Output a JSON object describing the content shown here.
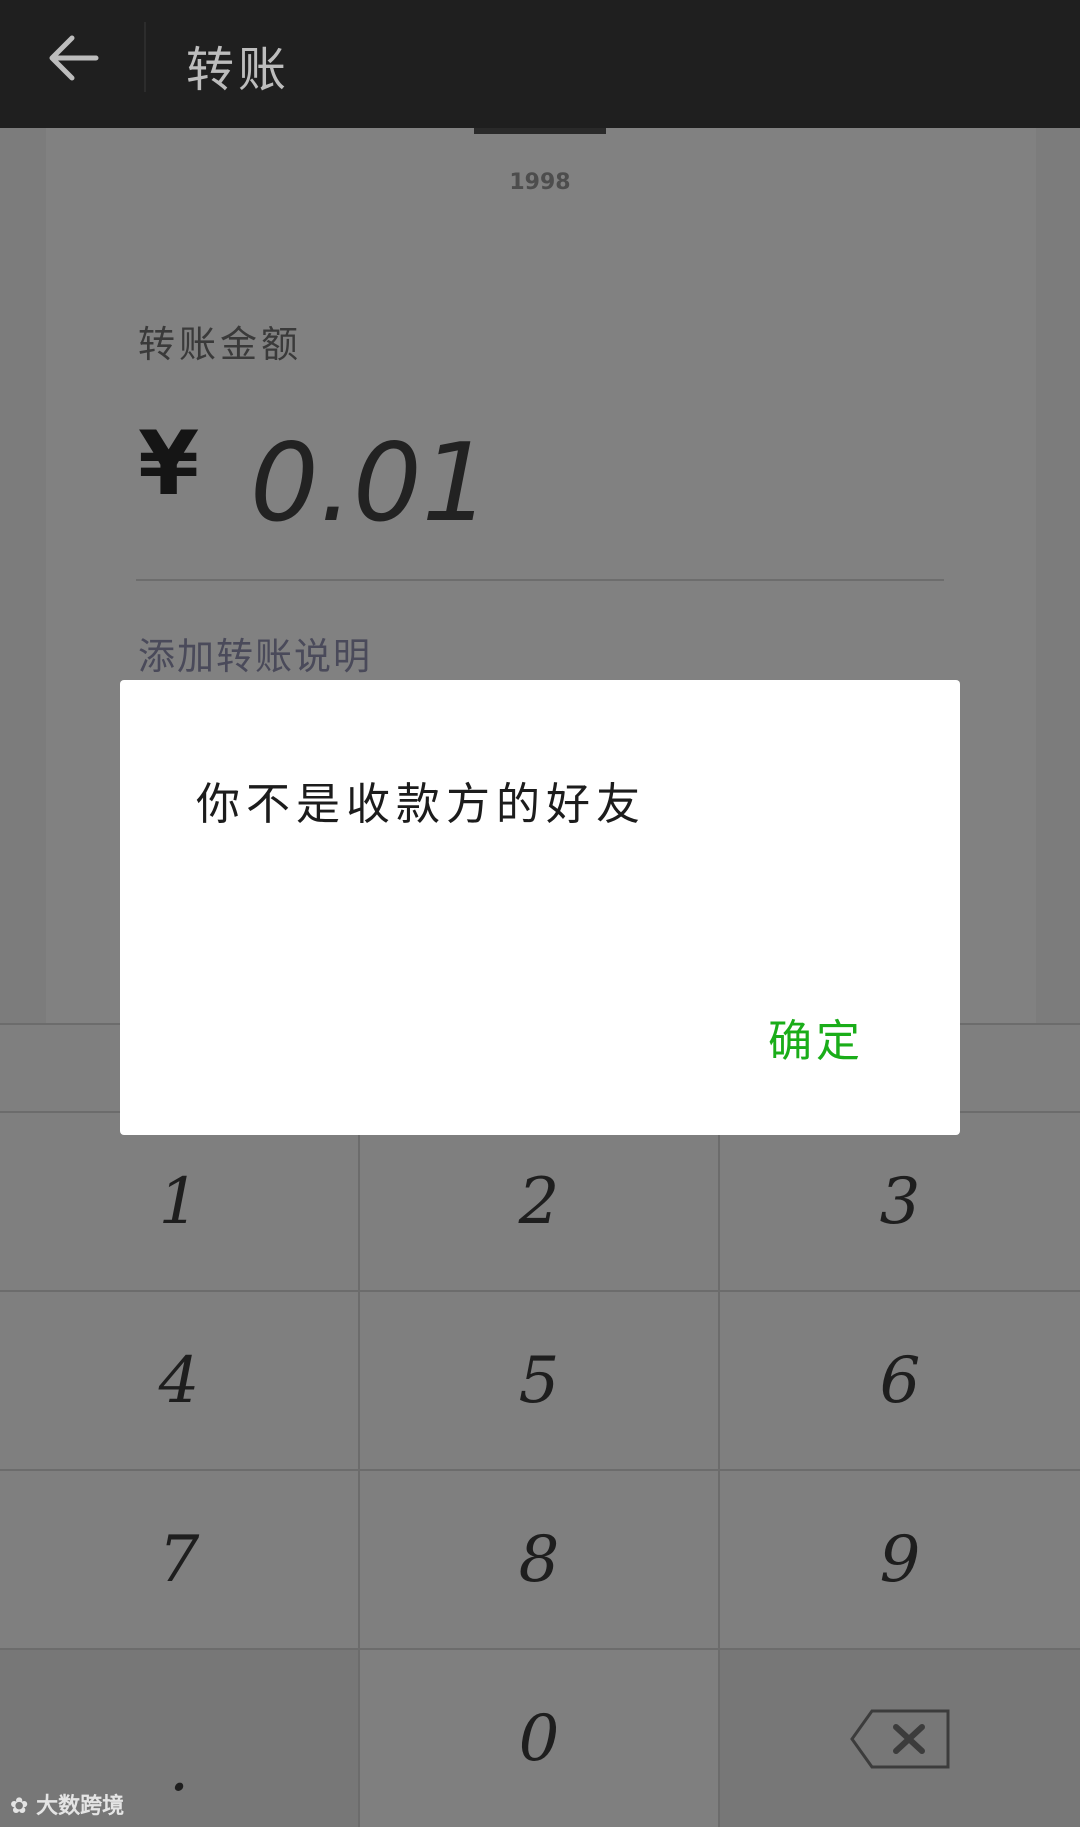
{
  "top_bar": {
    "title": "转账"
  },
  "recipient": {
    "name": "1998"
  },
  "amount": {
    "label": "转账金额",
    "currency_symbol": "¥",
    "value": "0.01"
  },
  "description_link": "添加转账说明",
  "keypad": {
    "keys": [
      "1",
      "2",
      "3",
      "4",
      "5",
      "6",
      "7",
      "8",
      "9",
      ".",
      "0"
    ],
    "delete_icon": "backspace-icon"
  },
  "dialog": {
    "message": "你不是收款方的好友",
    "confirm_label": "确定"
  },
  "watermark": "大数跨境",
  "colors": {
    "accent": "#1aad19",
    "top_bar": "#1f1f1f",
    "overlay_bg": "#7c7c7c"
  }
}
